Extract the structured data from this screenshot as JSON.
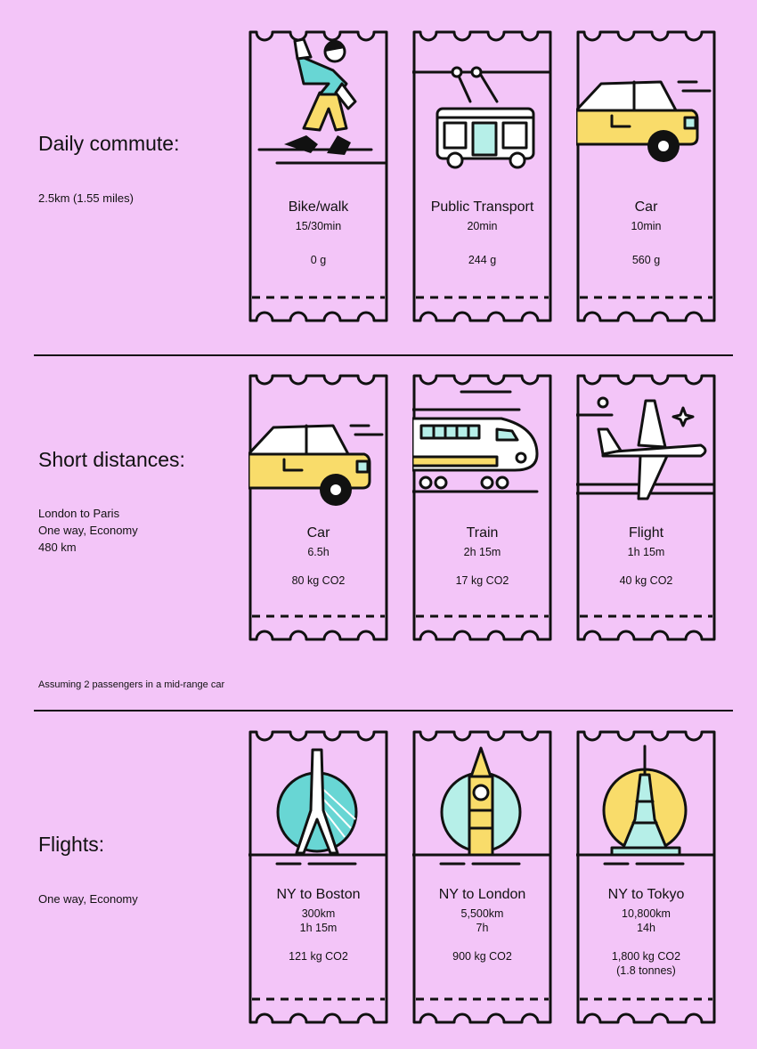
{
  "colors": {
    "background": "#f3c5f8",
    "teal": "#68d6d4",
    "yellow": "#f9dc6a",
    "line": "#111111",
    "light_teal": "#b6efe8"
  },
  "sections": [
    {
      "title": "Daily commute:",
      "subtitle": [
        "2.5km (1.55 miles)"
      ],
      "tickets": [
        {
          "icon": "walking-person-icon",
          "title": "Bike/walk",
          "sub": [
            "15/30min"
          ],
          "value": [
            "0 g"
          ]
        },
        {
          "icon": "tram-icon",
          "title": "Public Transport",
          "sub": [
            "20min"
          ],
          "value": [
            "244 g"
          ]
        },
        {
          "icon": "car-icon",
          "title": "Car",
          "sub": [
            "10min"
          ],
          "value": [
            "560 g"
          ]
        }
      ]
    },
    {
      "title": "Short distances:",
      "subtitle": [
        "London to Paris",
        "One way, Economy",
        "480 km"
      ],
      "note": "Assuming 2 passengers in a mid-range car",
      "tickets": [
        {
          "icon": "car-icon",
          "title": "Car",
          "sub": [
            "6.5h"
          ],
          "value": [
            "80 kg CO2"
          ]
        },
        {
          "icon": "train-icon",
          "title": "Train",
          "sub": [
            "2h 15m"
          ],
          "value": [
            "17 kg CO2"
          ]
        },
        {
          "icon": "airplane-icon",
          "title": "Flight",
          "sub": [
            "1h 15m"
          ],
          "value": [
            "40 kg CO2"
          ]
        }
      ]
    },
    {
      "title": "Flights:",
      "subtitle": [
        "One way, Economy"
      ],
      "tickets": [
        {
          "icon": "boston-bridge-icon",
          "title": "NY to Boston",
          "sub": [
            "300km",
            "1h 15m"
          ],
          "value": [
            "121 kg CO2"
          ]
        },
        {
          "icon": "big-ben-icon",
          "title": "NY to London",
          "sub": [
            "5,500km",
            "7h"
          ],
          "value": [
            "900 kg CO2"
          ]
        },
        {
          "icon": "tokyo-tower-icon",
          "title": "NY to Tokyo",
          "sub": [
            "10,800km",
            "14h"
          ],
          "value": [
            "1,800 kg CO2",
            "(1.8 tonnes)"
          ]
        }
      ]
    }
  ]
}
